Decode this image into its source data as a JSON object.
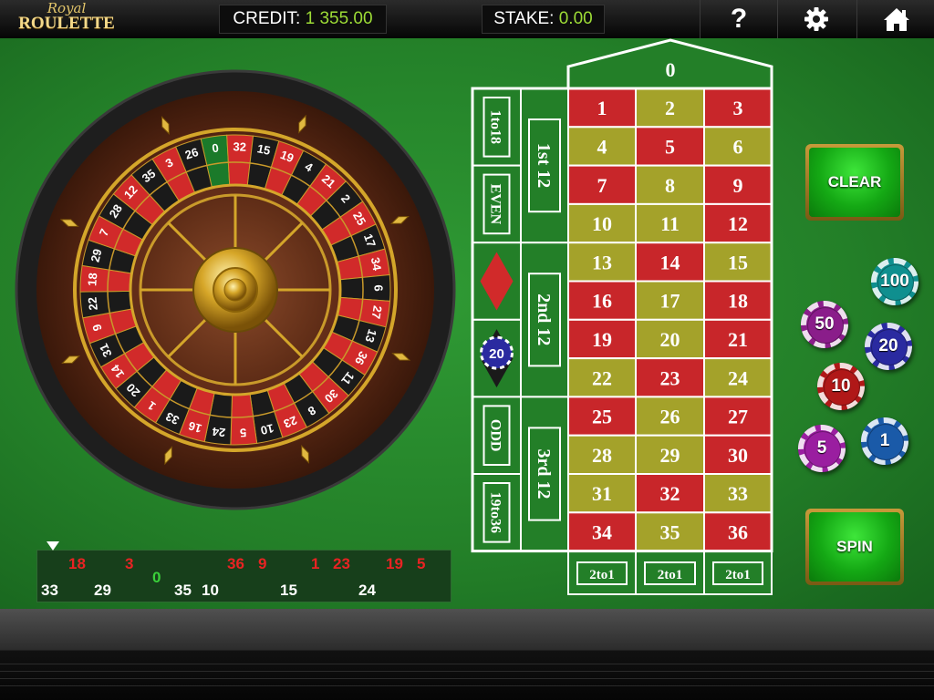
{
  "logo": {
    "line1": "Royal",
    "line2": "ROULETTE"
  },
  "header": {
    "credit_label": "CREDIT:",
    "credit_value": "1 355.00",
    "stake_label": "STAKE:",
    "stake_value": "0.00",
    "help_icon": "question-mark-icon",
    "settings_icon": "gear-icon",
    "home_icon": "home-icon"
  },
  "wheel": {
    "numbers": [
      "0",
      "32",
      "15",
      "19",
      "4",
      "21",
      "2",
      "25",
      "17",
      "34",
      "6",
      "27",
      "13",
      "36",
      "11",
      "30",
      "8",
      "23",
      "10",
      "5",
      "24",
      "16",
      "33",
      "1",
      "20",
      "14",
      "31",
      "9",
      "22",
      "18",
      "29",
      "7",
      "28",
      "12",
      "35",
      "3",
      "26"
    ]
  },
  "table": {
    "zero": "0",
    "numbers": [
      [
        "1",
        "2",
        "3"
      ],
      [
        "4",
        "5",
        "6"
      ],
      [
        "7",
        "8",
        "9"
      ],
      [
        "10",
        "11",
        "12"
      ],
      [
        "13",
        "14",
        "15"
      ],
      [
        "16",
        "17",
        "18"
      ],
      [
        "19",
        "20",
        "21"
      ],
      [
        "22",
        "23",
        "24"
      ],
      [
        "25",
        "26",
        "27"
      ],
      [
        "28",
        "29",
        "30"
      ],
      [
        "31",
        "32",
        "33"
      ],
      [
        "34",
        "35",
        "36"
      ]
    ],
    "dozens": [
      "1st 12",
      "2nd 12",
      "3rd 12"
    ],
    "outside": [
      "1to18",
      "EVEN",
      "ODD",
      "19to36"
    ],
    "columns": [
      "2to1",
      "2to1",
      "2to1"
    ],
    "placed_chip": "20",
    "colors": {
      "red": "#c8262a",
      "olive": "#a4a22a",
      "felt": "#237f28"
    }
  },
  "buttons": {
    "clear": "CLEAR",
    "spin": "SPIN"
  },
  "chips": [
    {
      "value": "100",
      "color": "#0f8f8f"
    },
    {
      "value": "50",
      "color": "#8a1d8a"
    },
    {
      "value": "20",
      "color": "#2a2aa0"
    },
    {
      "value": "10",
      "color": "#b01818"
    },
    {
      "value": "5",
      "color": "#9a1ea0"
    },
    {
      "value": "1",
      "color": "#1a5aa8"
    }
  ],
  "history": {
    "top": [
      {
        "n": "18",
        "c": "red"
      },
      {
        "n": "3",
        "c": "red"
      },
      {
        "n": "36",
        "c": "red"
      },
      {
        "n": "9",
        "c": "red"
      },
      {
        "n": "1",
        "c": "red"
      },
      {
        "n": "23",
        "c": "red"
      },
      {
        "n": "19",
        "c": "red"
      },
      {
        "n": "5",
        "c": "red"
      }
    ],
    "middle": [
      {
        "n": "0",
        "c": "green"
      }
    ],
    "bottom": [
      {
        "n": "33",
        "c": "white"
      },
      {
        "n": "29",
        "c": "white"
      },
      {
        "n": "35",
        "c": "white"
      },
      {
        "n": "10",
        "c": "white"
      },
      {
        "n": "15",
        "c": "white"
      },
      {
        "n": "24",
        "c": "white"
      }
    ]
  }
}
